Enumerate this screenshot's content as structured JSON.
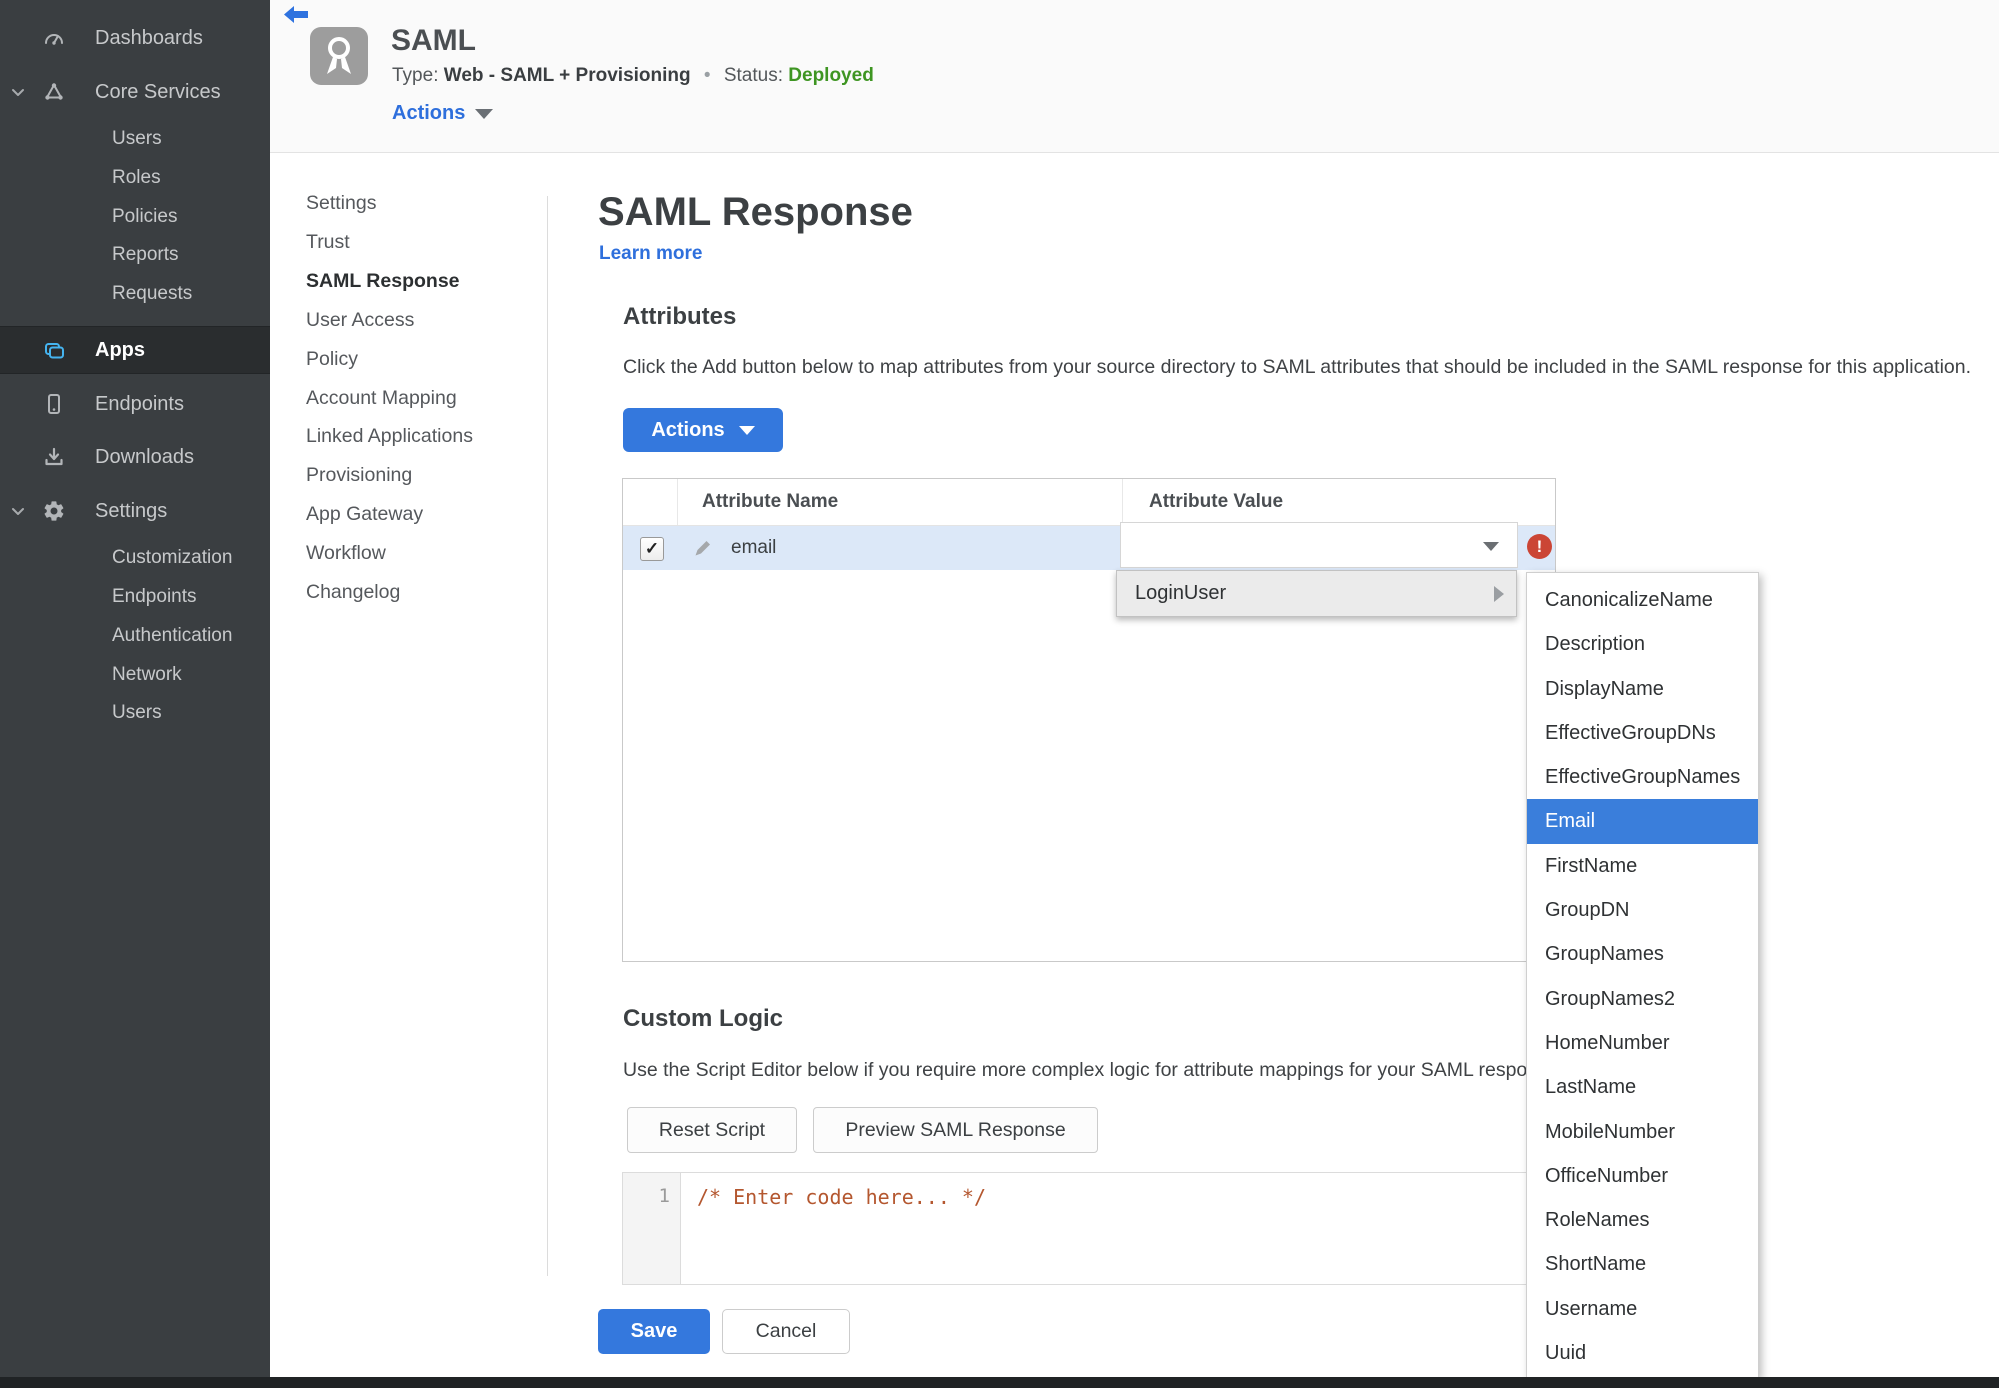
{
  "sidebar": {
    "items": [
      {
        "label": "Dashboards"
      },
      {
        "label": "Core Services"
      },
      {
        "label": "Users"
      },
      {
        "label": "Roles"
      },
      {
        "label": "Policies"
      },
      {
        "label": "Reports"
      },
      {
        "label": "Requests"
      },
      {
        "label": "Apps"
      },
      {
        "label": "Endpoints"
      },
      {
        "label": "Downloads"
      },
      {
        "label": "Settings"
      },
      {
        "label": "Customization"
      },
      {
        "label": "Endpoints"
      },
      {
        "label": "Authentication"
      },
      {
        "label": "Network"
      },
      {
        "label": "Users"
      }
    ]
  },
  "header": {
    "title": "SAML",
    "type_label": "Type:",
    "type_value": "Web - SAML + Provisioning",
    "separator": "•",
    "status_label": "Status:",
    "status_value": "Deployed",
    "actions_label": "Actions"
  },
  "subnav": {
    "items": [
      {
        "label": "Settings"
      },
      {
        "label": "Trust"
      },
      {
        "label": "SAML Response"
      },
      {
        "label": "User Access"
      },
      {
        "label": "Policy"
      },
      {
        "label": "Account Mapping"
      },
      {
        "label": "Linked Applications"
      },
      {
        "label": "Provisioning"
      },
      {
        "label": "App Gateway"
      },
      {
        "label": "Workflow"
      },
      {
        "label": "Changelog"
      }
    ]
  },
  "main": {
    "page_title": "SAML Response",
    "learn_more_label": "Learn more",
    "attributes": {
      "heading": "Attributes",
      "description": "Click the Add button below to map attributes from your source directory to SAML attributes that should be included in the SAML response for this application.",
      "actions_button_label": "Actions",
      "table": {
        "columns": [
          "Attribute Name",
          "Attribute Value"
        ],
        "rows": [
          {
            "attribute_name": "email",
            "attribute_value": "",
            "checked": true
          }
        ]
      }
    },
    "attribute_value_menu": {
      "parent_option": "LoginUser",
      "selected_option": "Email",
      "options": [
        "CanonicalizeName",
        "Description",
        "DisplayName",
        "EffectiveGroupDNs",
        "EffectiveGroupNames",
        "Email",
        "FirstName",
        "GroupDN",
        "GroupNames",
        "GroupNames2",
        "HomeNumber",
        "LastName",
        "MobileNumber",
        "OfficeNumber",
        "RoleNames",
        "ShortName",
        "Username",
        "Uuid"
      ]
    },
    "custom_logic": {
      "heading": "Custom Logic",
      "description": "Use the Script Editor below if you require more complex logic for attribute mappings for your SAML response.",
      "reset_button_label": "Reset Script",
      "preview_button_label": "Preview SAML Response",
      "editor": {
        "line_number": "1",
        "code": "/* Enter code here... */"
      }
    },
    "save_label": "Save",
    "cancel_label": "Cancel"
  },
  "icons": {
    "check": "✓",
    "error": "!"
  },
  "colors": {
    "accent_blue": "#3478dd",
    "link_blue": "#2e6fdc",
    "status_green": "#3e9522",
    "error_red": "#cb4535",
    "menu_selected_blue": "#3a7edb",
    "sidebar_bg": "#3a3e41",
    "sidebar_selected_bg": "#2a2d2f",
    "apps_icon_blue": "#45b4f0",
    "row_highlight_blue": "#dce8f8",
    "code_comment": "#b4572f"
  }
}
